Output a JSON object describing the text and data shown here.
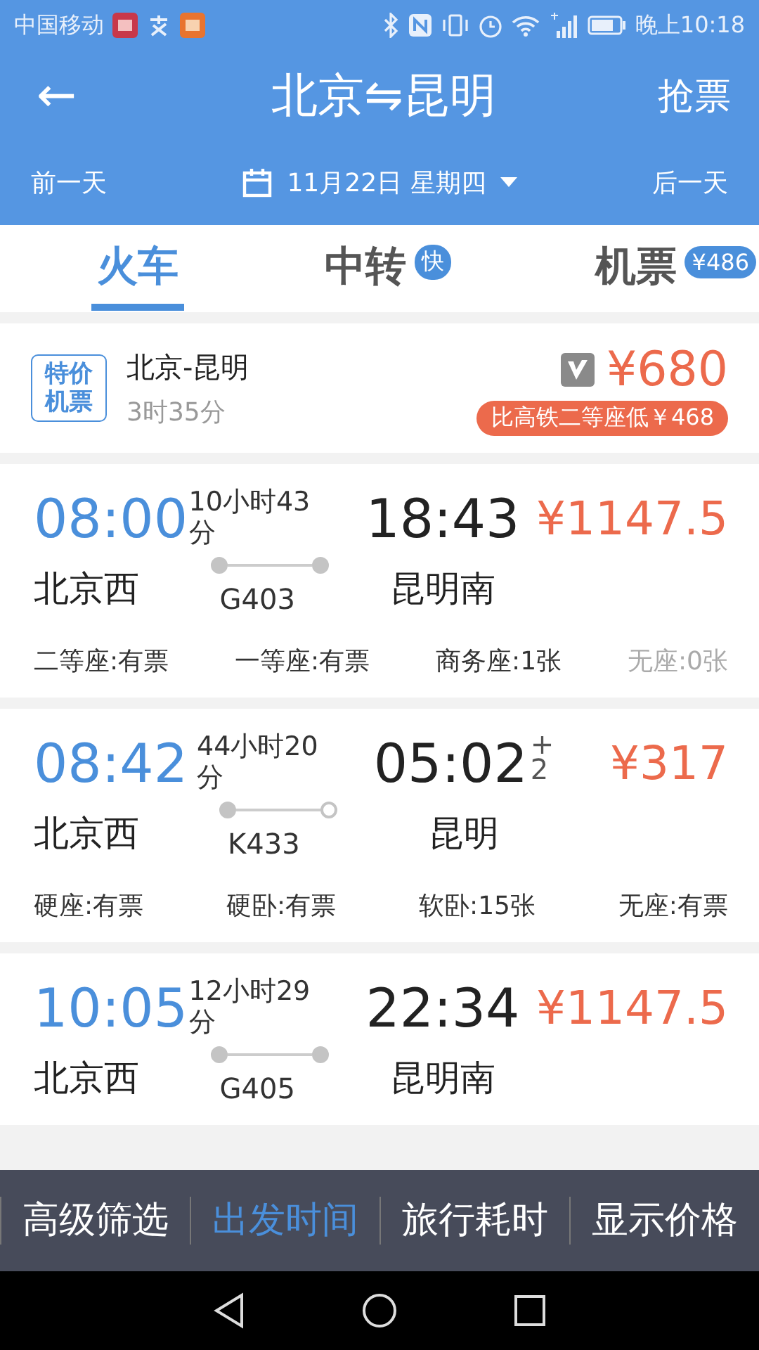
{
  "status_bar": {
    "carrier": "中国移动",
    "time": "晚上10:18"
  },
  "header": {
    "back": "←",
    "title": "北京⇋昆明",
    "action": "抢票",
    "prev_day": "前一天",
    "date": "11月22日 星期四",
    "next_day": "后一天"
  },
  "tabs": [
    {
      "label": "火车",
      "selected": true
    },
    {
      "label": "中转",
      "badge": "快",
      "selected": false
    },
    {
      "label": "机票",
      "badge": "¥486",
      "selected": false
    }
  ],
  "flight_offer": {
    "tag": "特价机票",
    "route": "北京-昆明",
    "duration": "3时35分",
    "price": "¥680",
    "note": "比高铁二等座低￥468"
  },
  "trains": [
    {
      "depart_time": "08:00",
      "depart_station": "北京西",
      "duration": "10小时43分",
      "train_no": "G403",
      "start_terminal": true,
      "end_terminal": true,
      "arrive_time": "18:43",
      "arrive_station": "昆明南",
      "price": "¥1147.5",
      "seats": [
        {
          "text": "二等座:有票",
          "available": true
        },
        {
          "text": "一等座:有票",
          "available": true
        },
        {
          "text": "商务座:1张",
          "available": true
        },
        {
          "text": "无座:0张",
          "available": false
        }
      ]
    },
    {
      "depart_time": "08:42",
      "depart_station": "北京西",
      "duration": "44小时20分",
      "train_no": "K433",
      "start_terminal": true,
      "end_terminal": false,
      "arrive_time": "05:02",
      "arrive_plus": "+",
      "arrive_days": "2",
      "arrive_station": "昆明",
      "price": "¥317",
      "seats": [
        {
          "text": "硬座:有票",
          "available": true
        },
        {
          "text": "硬卧:有票",
          "available": true
        },
        {
          "text": "软卧:15张",
          "available": true
        },
        {
          "text": "无座:有票",
          "available": true
        }
      ]
    },
    {
      "depart_time": "10:05",
      "depart_station": "北京西",
      "duration": "12小时29分",
      "train_no": "G405",
      "start_terminal": true,
      "end_terminal": true,
      "arrive_time": "22:34",
      "arrive_station": "昆明南",
      "price": "¥1147.5"
    }
  ],
  "filter_bar": [
    {
      "label": "高级筛选",
      "selected": false
    },
    {
      "label": "出发时间",
      "selected": true
    },
    {
      "label": "旅行耗时",
      "selected": false
    },
    {
      "label": "显示价格",
      "selected": false
    }
  ]
}
